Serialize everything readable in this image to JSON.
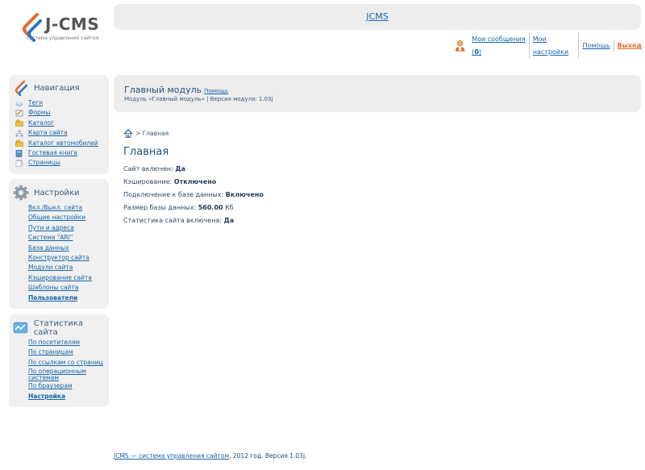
{
  "brand": {
    "logo_text": "J-CMS",
    "logo_sub": "система управления сайтом"
  },
  "header": {
    "title": "JCMS"
  },
  "userbar": {
    "messages_label": "Мои сообщения (",
    "messages_count": "0",
    "messages_close": ")",
    "settings": "Мои настройки",
    "help": "Помощь",
    "logout": "Выход"
  },
  "sidebar": {
    "navigation": {
      "title": "Навигация",
      "items": [
        {
          "label": "Теги",
          "icon": "tags-icon"
        },
        {
          "label": "Формы",
          "icon": "forms-icon"
        },
        {
          "label": "Каталог",
          "icon": "catalog-icon"
        },
        {
          "label": "Карта сайта",
          "icon": "sitemap-icon"
        },
        {
          "label": "Каталог автомобилей",
          "icon": "cars-icon"
        },
        {
          "label": "Гостевая книга",
          "icon": "guestbook-icon"
        },
        {
          "label": "Страницы",
          "icon": "pages-icon"
        }
      ]
    },
    "settings": {
      "title": "Настройки",
      "items": [
        "Вкл./Выкл. сайта",
        "Общие настройки",
        "Пути и адреса",
        "Система \"ARI\"",
        "База данных",
        "Конструктор сайта",
        "Модули сайта",
        "Кэширование сайта",
        "Шаблоны сайта",
        "Пользователи"
      ]
    },
    "stats": {
      "title": "Статистика сайта",
      "items": [
        "По посетителям",
        "По страницам",
        "По ссылкам со страниц",
        "По операционным системам",
        "По браузерам",
        "Настройка"
      ]
    }
  },
  "module": {
    "title": "Главный модуль",
    "help": "Помощь",
    "subtitle": "Модуль «Главный модуль» | Версия модуля: 1.03j"
  },
  "breadcrumb": {
    "separator": ">",
    "current": "Главная"
  },
  "main": {
    "heading": "Главная",
    "rows": [
      {
        "label": "Сайт включен:",
        "value": "Да",
        "suffix": ""
      },
      {
        "label": "Кэширование:",
        "value": "Отключено",
        "suffix": ""
      },
      {
        "label": "Подключение к базе данных:",
        "value": "Включено",
        "suffix": ""
      },
      {
        "label": "Размер базы данных:",
        "value": "560.00",
        "suffix": " Кб"
      },
      {
        "label": "Статистика сайта включена:",
        "value": "Да",
        "suffix": ""
      }
    ]
  },
  "footer": {
    "link": "JCMS — система управления сайтом",
    "text": ", 2012 год. Версия 1.03j."
  },
  "colors": {
    "accent": "#e36c2a",
    "link": "#1565a8",
    "panel": "#f0f0f0"
  }
}
